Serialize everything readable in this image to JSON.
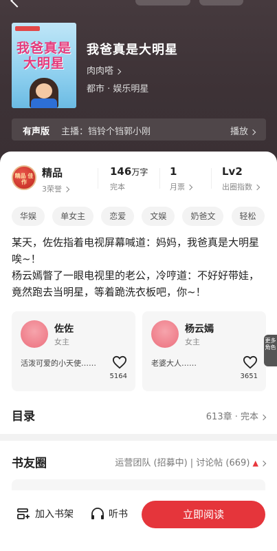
{
  "book": {
    "cover_title": "我爸真是大明星",
    "title": "我爸真是大明星",
    "author": "肉肉嗒",
    "genre": "都市 · 娱乐明星"
  },
  "audio": {
    "tag": "有声版",
    "anchor": "主播：铛铃个铛郭小刚",
    "play_label": "播放"
  },
  "stats": {
    "level": {
      "badge": "精品",
      "badge_icon_text": "精品 佳作",
      "value": "精品",
      "label": "3荣誉"
    },
    "words": {
      "value": "146",
      "unit": "万字",
      "label": "完本"
    },
    "tickets": {
      "value": "1",
      "label": "月票"
    },
    "rank": {
      "value": "Lv2",
      "label": "出圈指数"
    }
  },
  "tags": [
    "华娱",
    "单女主",
    "恋爱",
    "文娱",
    "奶爸文",
    "轻松"
  ],
  "synopsis": "某天，佐佐指着电视屏幕喊道：妈妈，我爸真是大明星唉~！\n杨云嫣瞥了一眼电视里的老公，冷哼道：不好好带娃，竟然跑去当明星，等着跪洗衣板吧，你~！",
  "characters": [
    {
      "name": "佐佐",
      "role": "女主",
      "desc": "活泼可爱的小天使……",
      "likes": "5164"
    },
    {
      "name": "杨云嫣",
      "role": "女主",
      "desc": "老婆大人……",
      "likes": "3651"
    }
  ],
  "more_roles": "更多角色",
  "toc": {
    "title": "目录",
    "info": "613章 · 完本"
  },
  "community": {
    "title": "书友圈",
    "info": "运营团队 (招募中) | 讨论帖 (669)"
  },
  "bottom": {
    "shelf": "加入书架",
    "listen": "听书",
    "read": "立即阅读"
  },
  "colors": {
    "accent": "#e5353b",
    "hero_bg": "#3d3236"
  }
}
